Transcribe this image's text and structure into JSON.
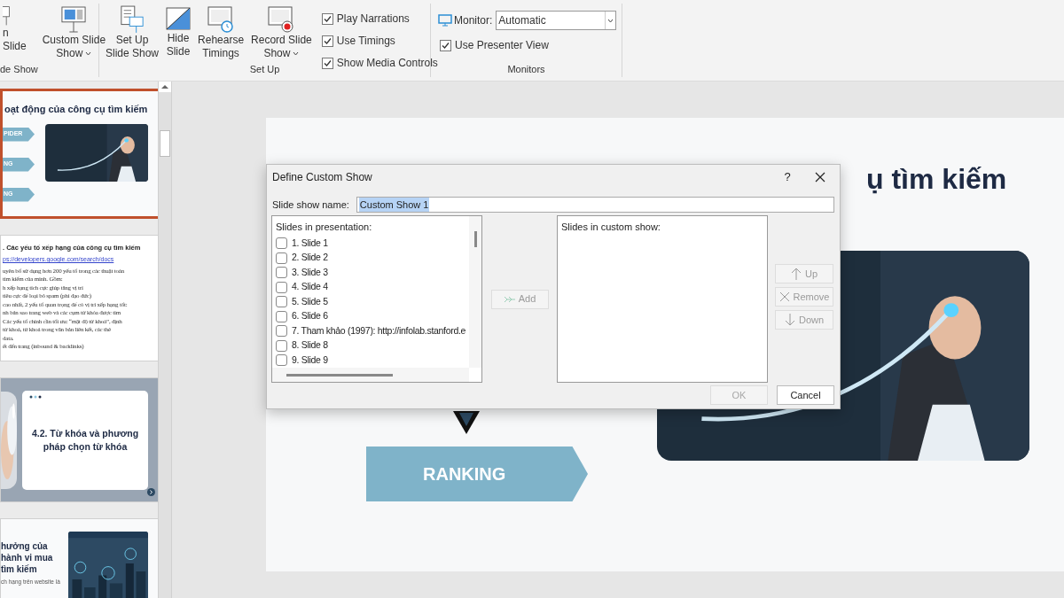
{
  "ribbon": {
    "groups": [
      {
        "label": "de Show",
        "buttons": [
          {
            "kind": "slide",
            "lines": [
              "n",
              "Slide"
            ],
            "dropdown": false
          },
          {
            "kind": "custom",
            "lines": [
              "Custom Slide",
              "Show"
            ],
            "dropdown": true
          }
        ]
      },
      {
        "label": "Set Up",
        "buttons": [
          {
            "kind": "setup",
            "lines": [
              "Set Up",
              "Slide Show"
            ],
            "dropdown": false
          },
          {
            "kind": "hide",
            "lines": [
              "Hide",
              "Slide"
            ],
            "dropdown": false
          },
          {
            "kind": "rehearse",
            "lines": [
              "Rehearse",
              "Timings"
            ],
            "dropdown": false
          },
          {
            "kind": "record",
            "lines": [
              "Record Slide",
              "Show"
            ],
            "dropdown": true
          }
        ],
        "checks": [
          {
            "label": "Play Narrations",
            "checked": true
          },
          {
            "label": "Use Timings",
            "checked": true
          },
          {
            "label": "Show Media Controls",
            "checked": true
          }
        ]
      },
      {
        "label": "Monitors",
        "monitor": {
          "label": "Monitor:",
          "value": "Automatic"
        },
        "checks": [
          {
            "label": "Use Presenter View",
            "checked": true
          }
        ]
      }
    ]
  },
  "thumbnails": [
    {
      "kind": "chevrons",
      "selected": true,
      "title": "oạt động của công cụ tìm kiếm",
      "chevrons": [
        "PIDER",
        "NG",
        "NG"
      ]
    },
    {
      "kind": "text",
      "selected": false,
      "title": ". Các yếu tố xếp hạng của công cụ tìm kiếm",
      "link": "ps://developers.google.com/search/docs",
      "lines": [
        "uyên bố sử dụng hơn 200 yếu tố trong các thuật toán",
        "tìm kiếm của mình. Gồm:",
        "h xếp hạng tích cực giúp tăng vị trí",
        "tiêu cực để loại bỏ spam (phi đạo đức)",
        "cao nhất, 2 yếu tố quan trọng để có vị trí xếp hạng tốt:",
        "nh bản sao trang web và các cụm từ khóa được tìm",
        "Các yếu tố chính cần tối ưu: “mật độ từ khoá”, định",
        "từ khoá, từ khoá trong văn bản liên kết, các thẻ",
        "data.",
        "ết đến trang (inbound & backlinks)"
      ]
    },
    {
      "kind": "card",
      "selected": false,
      "title": "4.2. Từ khóa và phương pháp chọn từ khóa"
    },
    {
      "kind": "city",
      "selected": false,
      "title": "hưởng của hành vi mua tìm kiếm",
      "lines": [
        "ch hạng trên website là"
      ]
    }
  ],
  "slide": {
    "title": "ụ tìm kiếm",
    "chevron": "RANKING"
  },
  "dialog": {
    "title": "Define Custom Show",
    "help": "?",
    "name_label": "Slide show name:",
    "name_value": "Custom Show 1",
    "name_selected": true,
    "left": {
      "label": "Slides in presentation:",
      "items": [
        {
          "label": "1. Slide 1",
          "checked": false
        },
        {
          "label": "2. Slide 2",
          "checked": false
        },
        {
          "label": "3. Slide 3",
          "checked": false
        },
        {
          "label": "4. Slide 4",
          "checked": false
        },
        {
          "label": "5. Slide 5",
          "checked": false
        },
        {
          "label": "6. Slide 6",
          "checked": false
        },
        {
          "label": "7. Tham khảo (1997): http://infolab.stanford.e",
          "checked": false
        },
        {
          "label": "8. Slide 8",
          "checked": false
        },
        {
          "label": "9. Slide 9",
          "checked": false
        }
      ]
    },
    "add": {
      "label": "Add",
      "disabled": true
    },
    "right": {
      "label": "Slides in custom show:"
    },
    "side_buttons": [
      {
        "kind": "up",
        "label": "Up",
        "disabled": true
      },
      {
        "kind": "remove",
        "label": "Remove",
        "disabled": true
      },
      {
        "kind": "down",
        "label": "Down",
        "disabled": true
      }
    ],
    "footer": [
      {
        "label": "OK",
        "disabled": true
      },
      {
        "label": "Cancel",
        "disabled": false
      }
    ]
  }
}
